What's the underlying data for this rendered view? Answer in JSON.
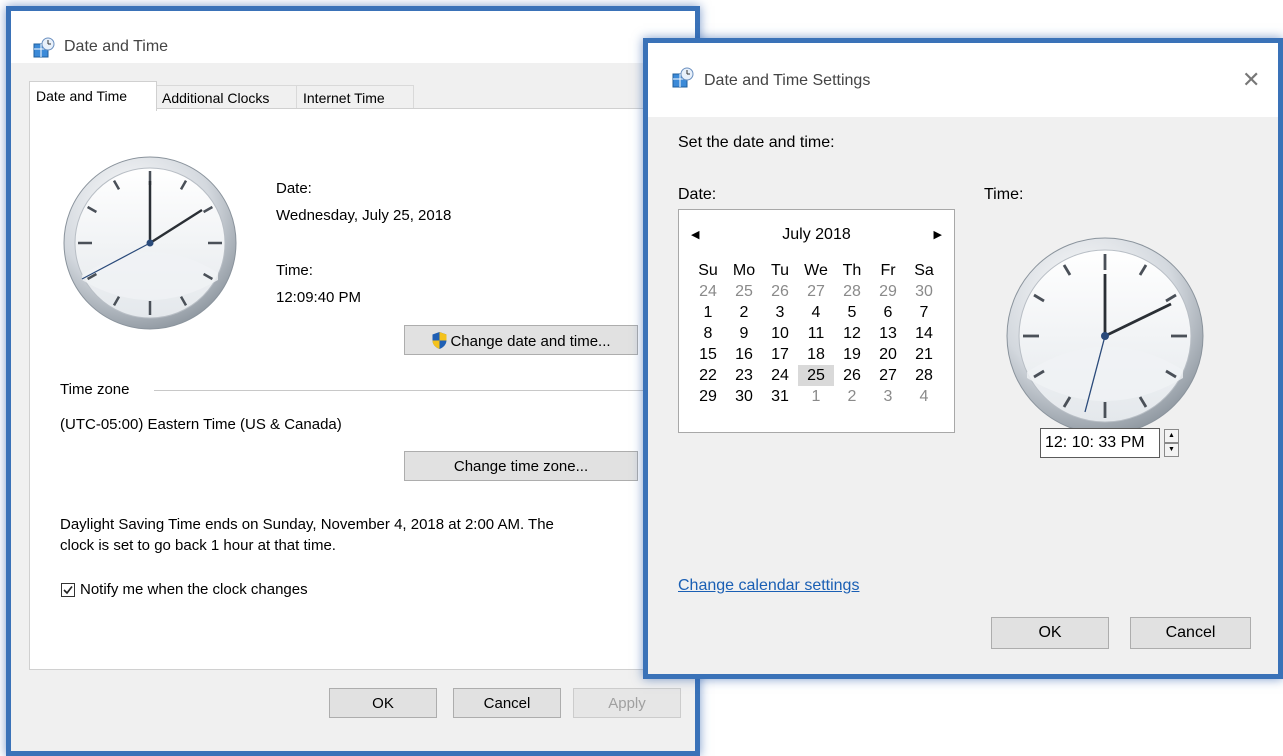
{
  "main_window": {
    "title": "Date and Time",
    "tabs": [
      "Date and Time",
      "Additional Clocks",
      "Internet Time"
    ],
    "date_label": "Date:",
    "date_value": "Wednesday, July 25, 2018",
    "time_label": "Time:",
    "time_value": "12:09:40 PM",
    "change_datetime_button": "Change date and time...",
    "timezone_label": "Time zone",
    "timezone_value": "(UTC-05:00) Eastern Time (US & Canada)",
    "change_timezone_button": "Change time zone...",
    "dst_line1": "Daylight Saving Time ends on Sunday, November 4, 2018 at 2:00 AM. The",
    "dst_line2": "clock is set to go back 1 hour at that time.",
    "notify_label": "Notify me when the clock changes",
    "notify_checked": true,
    "ok_button": "OK",
    "cancel_button": "Cancel",
    "apply_button": "Apply"
  },
  "settings_window": {
    "title": "Date and Time Settings",
    "heading": "Set the date and time:",
    "date_label": "Date:",
    "time_label": "Time:",
    "calendar": {
      "month_year": "July 2018",
      "weekdays": [
        "Su",
        "Mo",
        "Tu",
        "We",
        "Th",
        "Fr",
        "Sa"
      ],
      "weeks": [
        [
          "24",
          "25",
          "26",
          "27",
          "28",
          "29",
          "30"
        ],
        [
          "1",
          "2",
          "3",
          "4",
          "5",
          "6",
          "7"
        ],
        [
          "8",
          "9",
          "10",
          "11",
          "12",
          "13",
          "14"
        ],
        [
          "15",
          "16",
          "17",
          "18",
          "19",
          "20",
          "21"
        ],
        [
          "22",
          "23",
          "24",
          "25",
          "26",
          "27",
          "28"
        ],
        [
          "29",
          "30",
          "31",
          "1",
          "2",
          "3",
          "4"
        ]
      ],
      "selected_day": "25"
    },
    "time_value": "12: 10: 33 PM",
    "change_calendar_link": "Change calendar settings",
    "ok_button": "OK",
    "cancel_button": "Cancel"
  },
  "icons": {
    "close": "close-icon",
    "window": "date-time-window-icon",
    "shield": "uac-shield-icon"
  },
  "colors": {
    "window_border": "#3a72b8",
    "link": "#1a5fb4",
    "selected_day": "#d9d9d9"
  }
}
